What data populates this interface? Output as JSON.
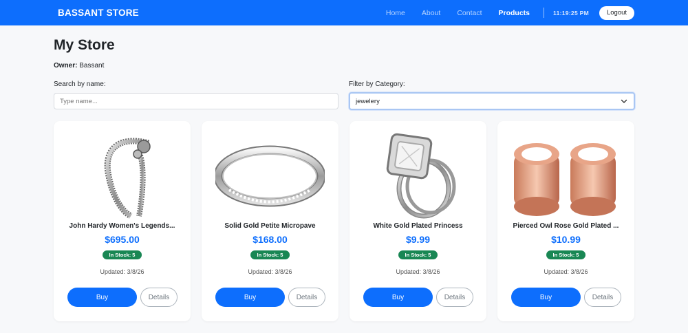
{
  "navbar": {
    "brand": "BASSANT STORE",
    "links": [
      "Home",
      "About",
      "Contact",
      "Products"
    ],
    "active_link": "Products",
    "clock": "11:19:25 PM",
    "logout_label": "Logout"
  },
  "page": {
    "title": "My Store",
    "owner_label": "Owner:",
    "owner_name": "Bassant"
  },
  "filters": {
    "search_label": "Search by name:",
    "search_placeholder": "Type name...",
    "search_value": "",
    "category_label": "Filter by Category:",
    "category_value": "jewelery"
  },
  "products": [
    {
      "name": "John Hardy Women's Legends...",
      "price": "$695.00",
      "stock": "In Stock: 5",
      "updated": "Updated: 3/8/26",
      "buy_label": "Buy",
      "details_label": "Details",
      "image_icon": "bracelet-image"
    },
    {
      "name": "Solid Gold Petite Micropave",
      "price": "$168.00",
      "stock": "In Stock: 5",
      "updated": "Updated: 3/8/26",
      "buy_label": "Buy",
      "details_label": "Details",
      "image_icon": "ring-image"
    },
    {
      "name": "White Gold Plated Princess",
      "price": "$9.99",
      "stock": "In Stock: 5",
      "updated": "Updated: 3/8/26",
      "buy_label": "Buy",
      "details_label": "Details",
      "image_icon": "princess-ring-image"
    },
    {
      "name": "Pierced Owl Rose Gold Plated ...",
      "price": "$10.99",
      "stock": "In Stock: 5",
      "updated": "Updated: 3/8/26",
      "buy_label": "Buy",
      "details_label": "Details",
      "image_icon": "plug-earrings-image"
    }
  ],
  "colors": {
    "primary": "#0d6efd",
    "success": "#198754",
    "background": "#f7f8fa"
  }
}
